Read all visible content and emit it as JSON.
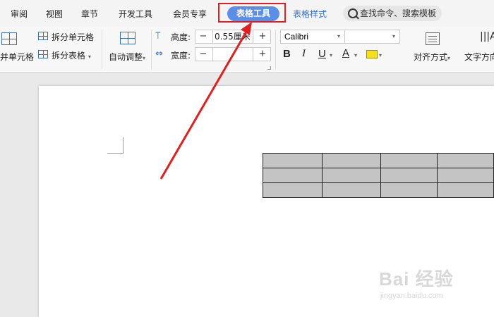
{
  "menu": {
    "tabs": [
      "审阅",
      "视图",
      "章节",
      "开发工具",
      "会员专享"
    ],
    "active_tab": "表格工具",
    "next_tab": "表格样式",
    "search_placeholder": "查找命令、搜索模板"
  },
  "ribbon": {
    "merge_cells": "并单元格",
    "split_cells": "拆分单元格",
    "split_table": "拆分表格",
    "auto_fit": "自动调整",
    "height_label": "高度:",
    "height_value": "0.55厘米",
    "width_label": "宽度:",
    "width_value": "",
    "font_name": "Calibri",
    "bold": "B",
    "italic": "I",
    "underline": "U",
    "font_color": "A",
    "align": "对齐方式",
    "text_direction": "文字方向"
  },
  "document": {
    "table_rows": 3,
    "table_cols": 4
  },
  "colors": {
    "accent": "#5b8ee6",
    "highlight_box": "#e02020",
    "table_fill": "#c4c4c4"
  },
  "watermark": {
    "logo": "Bai 经验",
    "url": "jingyan.baidu.com"
  }
}
